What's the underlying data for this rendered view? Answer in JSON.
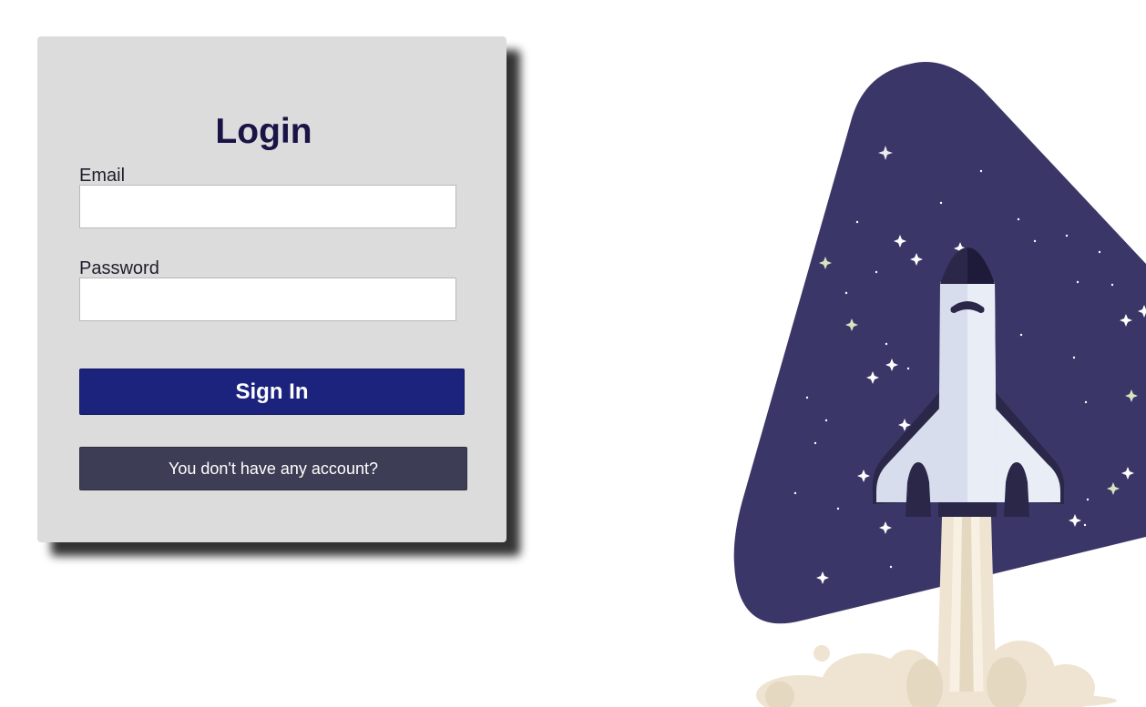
{
  "login": {
    "title": "Login",
    "email_label": "Email",
    "email_value": "",
    "password_label": "Password",
    "password_value": "",
    "signin_label": "Sign In",
    "register_label": "You don't have any account?"
  },
  "colors": {
    "card_background": "#dcdcdc",
    "title_color": "#1a1446",
    "signin_button": "#1b237d",
    "register_button": "#3d3d55",
    "illustration_background": "#3a3768",
    "smoke": "#efe4d2"
  },
  "illustration": {
    "icon": "rocket-launch-illustration"
  }
}
